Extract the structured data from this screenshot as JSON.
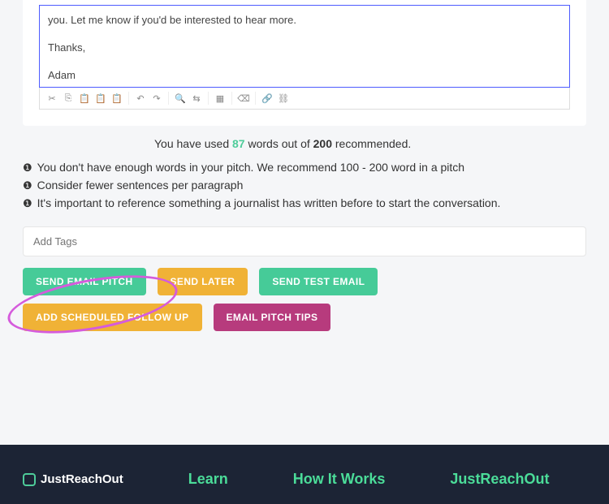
{
  "editor": {
    "line1": "you. Let me know if you'd be interested to hear more.",
    "line2": "Thanks,",
    "line3": "Adam"
  },
  "word_count": {
    "prefix": "You have used ",
    "used": "87",
    "mid": " words out of ",
    "max": "200",
    "suffix": " recommended."
  },
  "tips": [
    "You don't have enough words in your pitch. We recommend 100 - 200 word in a pitch",
    "Consider fewer sentences per paragraph",
    "It's important to reference something a journalist has written before to start the conversation."
  ],
  "tag_placeholder": "Add Tags",
  "buttons": {
    "send_pitch": "Send Email Pitch",
    "send_later": "Send Later",
    "send_test": "Send Test Email",
    "add_follow": "Add Scheduled Follow Up",
    "pitch_tips": "Email Pitch Tips"
  },
  "footer": {
    "brand": "JustReachOut",
    "links": [
      "Learn",
      "How It Works",
      "JustReachOut"
    ]
  }
}
